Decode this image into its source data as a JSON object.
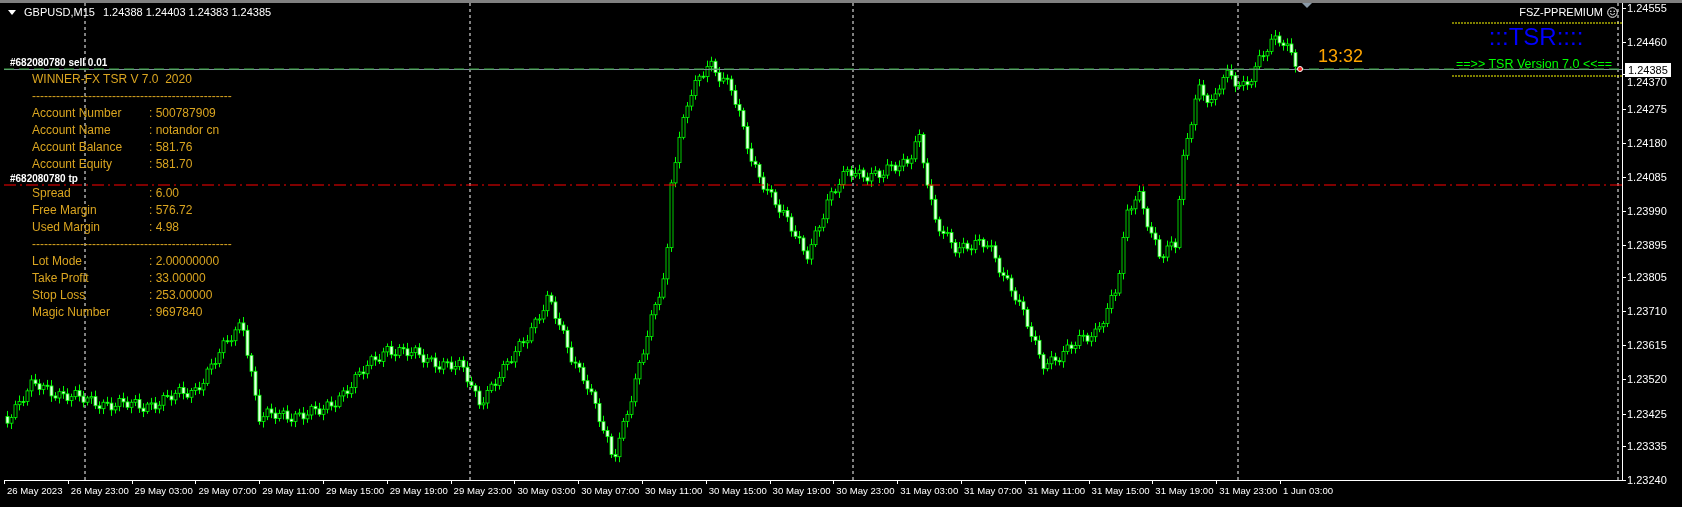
{
  "chart_header": {
    "symbol": "GBPUSD,M15",
    "ohlc": "1.24388 1.24403 1.24383 1.24385"
  },
  "broker_label": "FSZ-PPREMIUM",
  "indicator": {
    "title": ":::TSR::::",
    "version": "==>> TSR Version 7.0 <<==",
    "countdown": "13:32"
  },
  "order_lines": [
    {
      "kind": "entry",
      "label": "#682080780 sell 0.01"
    },
    {
      "kind": "take-profit",
      "label": "#682080780 tp"
    }
  ],
  "info_panel": [
    {
      "kind": "title",
      "text": "WINNER-FX TSR V 7.0  2020"
    },
    {
      "kind": "separator",
      "text": "--------------------------------------------------"
    },
    {
      "kind": "field",
      "label": "Account Number",
      "value": ": 500787909"
    },
    {
      "kind": "field",
      "label": "Account Name",
      "value": ": notandor cn"
    },
    {
      "kind": "field",
      "label": "Account Balance",
      "value": ": 581.76"
    },
    {
      "kind": "field",
      "label": "Account Equity",
      "value": ": 581.70"
    },
    {
      "kind": "field",
      "label": "Spread",
      "value": ": 6.00"
    },
    {
      "kind": "field",
      "label": "Free Margin",
      "value": ": 576.72"
    },
    {
      "kind": "field",
      "label": "Used Margin",
      "value": ": 4.98"
    },
    {
      "kind": "separator",
      "text": "--------------------------------------------------"
    },
    {
      "kind": "field",
      "label": "Lot Mode",
      "value": ": 2.00000000"
    },
    {
      "kind": "field",
      "label": "Take Profit",
      "value": ": 33.00000"
    },
    {
      "kind": "field",
      "label": "Stop Loss",
      "value": ": 253.00000"
    },
    {
      "kind": "field",
      "label": "Magic Number",
      "value": ": 9697840"
    }
  ],
  "price_axis": {
    "current_price": "1.24385",
    "ticks": [
      "1.24555",
      "1.24460",
      "1.24370",
      "1.24275",
      "1.24180",
      "1.24085",
      "1.23990",
      "1.23895",
      "1.23805",
      "1.23710",
      "1.23615",
      "1.23520",
      "1.23425",
      "1.23335",
      "1.23240"
    ]
  },
  "time_axis": {
    "labels": [
      "26 May 2023",
      "26 May 23:00",
      "29 May 03:00",
      "29 May 07:00",
      "29 May 11:00",
      "29 May 15:00",
      "29 May 19:00",
      "29 May 23:00",
      "30 May 03:00",
      "30 May 07:00",
      "30 May 11:00",
      "30 May 15:00",
      "30 May 19:00",
      "30 May 23:00",
      "31 May 03:00",
      "31 May 07:00",
      "31 May 11:00",
      "31 May 15:00",
      "31 May 19:00",
      "31 May 23:00",
      "1 Jun 03:00"
    ]
  }
}
